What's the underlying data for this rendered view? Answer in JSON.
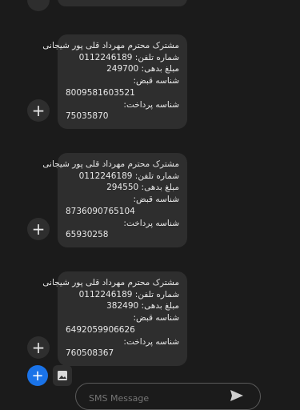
{
  "messages": [
    {
      "line1": "مشترک محترم مهرداد قلی پور شیجانی",
      "line2_label": "شماره تلفن:",
      "line2_value": "0112246189",
      "line3_label": "مبلغ بدهی:",
      "line3_value": "249700",
      "line4_label": "شناسه قبض:",
      "bill_id": "8009581603521",
      "line6_label": "شناسه پرداخت:",
      "payment_id": "75035870"
    },
    {
      "line1": "مشترک محترم مهرداد قلی پور شیجانی",
      "line2_label": "شماره تلفن:",
      "line2_value": "0112246189",
      "line3_label": "مبلغ بدهی:",
      "line3_value": "294550",
      "line4_label": "شناسه قبض:",
      "bill_id": "8736090765104",
      "line6_label": "شناسه پرداخت:",
      "payment_id": "65930258"
    },
    {
      "line1": "مشترک محترم مهرداد قلی پور شیجانی",
      "line2_label": "شماره تلفن:",
      "line2_value": "0112246189",
      "line3_label": "مبلغ بدهی:",
      "line3_value": "382490",
      "line4_label": "شناسه قبض:",
      "bill_id": "6492059906626",
      "line6_label": "شناسه پرداخت:",
      "payment_id": "760508367"
    }
  ],
  "composer": {
    "placeholder": "SMS Message"
  },
  "icons": {
    "message_action": "plus-icon",
    "attach": "plus-icon",
    "gallery": "image-gallery-icon",
    "send": "send-icon"
  },
  "colors": {
    "background": "#1b1b1b",
    "bubble": "#2e2e2e",
    "accent": "#1a73e8"
  }
}
